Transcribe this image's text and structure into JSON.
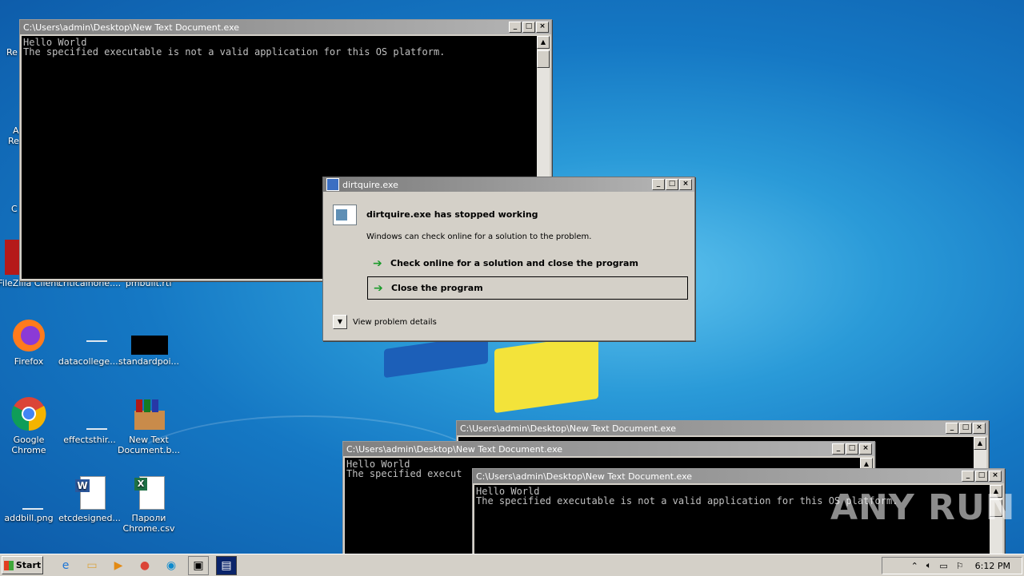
{
  "desktop": {
    "icons": [
      {
        "id": "filezilla",
        "label": "FileZilla Client"
      },
      {
        "id": "critical",
        "label": "criticalnone...."
      },
      {
        "id": "pmbuilt",
        "label": "pmbuilt.rtf"
      },
      {
        "id": "firefox",
        "label": "Firefox"
      },
      {
        "id": "datacollege",
        "label": "datacollege...."
      },
      {
        "id": "standardpol",
        "label": "standardpoi..."
      },
      {
        "id": "chrome",
        "label": "Google Chrome"
      },
      {
        "id": "effectsthir",
        "label": "effectsthir..."
      },
      {
        "id": "newtextdoc",
        "label": "New Text Document.b..."
      },
      {
        "id": "addbill",
        "label": "addbill.png"
      },
      {
        "id": "etcdesigned",
        "label": "etcdesigned..."
      },
      {
        "id": "paroli",
        "label": "Пароли Chrome.csv"
      }
    ],
    "partial_labels": [
      "Re",
      "A",
      "Re",
      "C"
    ]
  },
  "console_windows": [
    {
      "title": "C:\\Users\\admin\\Desktop\\New Text Document.exe",
      "lines": [
        "Hello World",
        "The specified executable is not a valid application for this OS platform."
      ]
    },
    {
      "title": "C:\\Users\\admin\\Desktop\\New Text Document.exe",
      "lines": []
    },
    {
      "title": "C:\\Users\\admin\\Desktop\\New Text Document.exe",
      "lines": [
        "Hello World",
        "The specified execut"
      ]
    },
    {
      "title": "C:\\Users\\admin\\Desktop\\New Text Document.exe",
      "lines": [
        "Hello World",
        "The specified executable is not a valid application for this OS platform."
      ]
    }
  ],
  "dialog": {
    "title": "dirtquire.exe",
    "heading": "dirtquire.exe has stopped working",
    "subtext": "Windows can check online for a solution to the problem.",
    "option_check": "Check online for a solution and close the program",
    "option_close": "Close the program",
    "details": "View problem details"
  },
  "taskbar": {
    "start_label": "Start",
    "clock": "6:12 PM",
    "apps": [
      "ie-icon",
      "explorer-icon",
      "media-player-icon",
      "chrome-icon",
      "edge-icon",
      "console-icon",
      "dialog-icon"
    ]
  },
  "watermark": "ANY RUN",
  "colors": {
    "title_active": "#0a246a",
    "title_inactive": "#808080",
    "console_bg": "#000000",
    "console_fg": "#c0c0c0",
    "desktop": "#1578c4"
  }
}
